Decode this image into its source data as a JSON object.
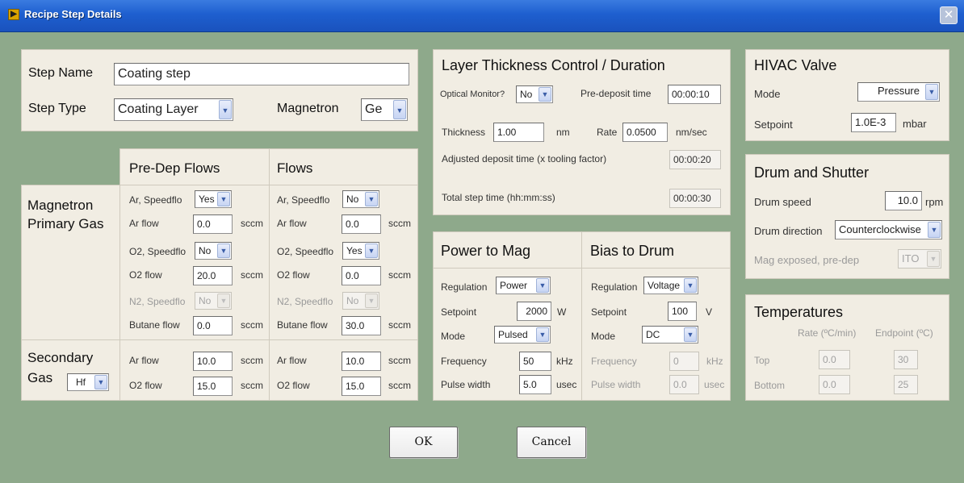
{
  "window": {
    "title": "Recipe Step Details",
    "icon": "labview-icon",
    "close_glyph": "✕"
  },
  "step": {
    "name_label": "Step Name",
    "name_value": "Coating step",
    "type_label": "Step Type",
    "type_value": "Coating Layer",
    "magnetron_label": "Magnetron",
    "magnetron_value": "Ge"
  },
  "flows": {
    "predep_header": "Pre-Dep Flows",
    "flows_header": "Flows",
    "magnetron_primary_gas": [
      "Magnetron",
      "Primary Gas"
    ],
    "secondary_gas": [
      "Secondary",
      "Gas"
    ],
    "secondary_gas_value": "Hf",
    "unit": "sccm",
    "predep": {
      "ar_speedflo_label": "Ar, Speedflo",
      "ar_speedflo": "Yes",
      "ar_flow_label": "Ar flow",
      "ar_flow": "0.0",
      "o2_speedflo_label": "O2, Speedflo",
      "o2_speedflo": "No",
      "o2_flow_label": "O2 flow",
      "o2_flow": "20.0",
      "n2_speedflo_label": "N2, Speedflo",
      "n2_speedflo": "No",
      "butane_flow_label": "Butane flow",
      "butane_flow": "0.0",
      "sec_ar_flow_label": "Ar flow",
      "sec_ar_flow": "10.0",
      "sec_o2_flow_label": "O2 flow",
      "sec_o2_flow": "15.0"
    },
    "main": {
      "ar_speedflo_label": "Ar, Speedflo",
      "ar_speedflo": "No",
      "ar_flow_label": "Ar flow",
      "ar_flow": "0.0",
      "o2_speedflo_label": "O2, Speedflo",
      "o2_speedflo": "Yes",
      "o2_flow_label": "O2 flow",
      "o2_flow": "0.0",
      "n2_speedflo_label": "N2, Speedflo",
      "n2_speedflo": "No",
      "butane_flow_label": "Butane flow",
      "butane_flow": "30.0",
      "sec_ar_flow_label": "Ar flow",
      "sec_ar_flow": "10.0",
      "sec_o2_flow_label": "O2 flow",
      "sec_o2_flow": "15.0"
    }
  },
  "layer": {
    "header": "Layer Thickness Control / Duration",
    "optical_monitor_label": "Optical Monitor?",
    "optical_monitor": "No",
    "predeposit_label": "Pre-deposit time",
    "predeposit": "00:00:10",
    "thickness_label": "Thickness",
    "thickness": "1.00",
    "thickness_unit": "nm",
    "rate_label": "Rate",
    "rate": "0.0500",
    "rate_unit": "nm/sec",
    "adjusted_label": "Adjusted deposit time (x tooling factor)",
    "adjusted": "00:00:20",
    "total_label": "Total step time (hh:mm:ss)",
    "total": "00:00:30"
  },
  "power": {
    "header": "Power to Mag",
    "regulation_label": "Regulation",
    "regulation": "Power",
    "setpoint_label": "Setpoint",
    "setpoint": "2000",
    "setpoint_unit": "W",
    "mode_label": "Mode",
    "mode": "Pulsed",
    "frequency_label": "Frequency",
    "frequency": "50",
    "frequency_unit": "kHz",
    "pulse_label": "Pulse width",
    "pulse": "5.0",
    "pulse_unit": "usec"
  },
  "bias": {
    "header": "Bias to Drum",
    "regulation_label": "Regulation",
    "regulation": "Voltage",
    "setpoint_label": "Setpoint",
    "setpoint": "100",
    "setpoint_unit": "V",
    "mode_label": "Mode",
    "mode": "DC",
    "frequency_label": "Frequency",
    "frequency": "0",
    "frequency_unit": "kHz",
    "pulse_label": "Pulse width",
    "pulse": "0.0",
    "pulse_unit": "usec"
  },
  "hivac": {
    "header": "HIVAC Valve",
    "mode_label": "Mode",
    "mode": "Pressure",
    "setpoint_label": "Setpoint",
    "setpoint": "1.0E-3",
    "setpoint_unit": "mbar"
  },
  "drum": {
    "header": "Drum and Shutter",
    "speed_label": "Drum speed",
    "speed": "10.0",
    "speed_unit": "rpm",
    "direction_label": "Drum direction",
    "direction": "Counterclockwise",
    "exposed_label": "Mag exposed, pre-dep",
    "exposed": "ITO"
  },
  "temps": {
    "header": "Temperatures",
    "rate_header": "Rate (ºC/min)",
    "endpoint_header": "Endpoint (ºC)",
    "top_label": "Top",
    "top_rate": "0.0",
    "top_endpoint": "30",
    "bottom_label": "Bottom",
    "bottom_rate": "0.0",
    "bottom_endpoint": "25"
  },
  "buttons": {
    "ok": "OK",
    "cancel": "Cancel"
  }
}
